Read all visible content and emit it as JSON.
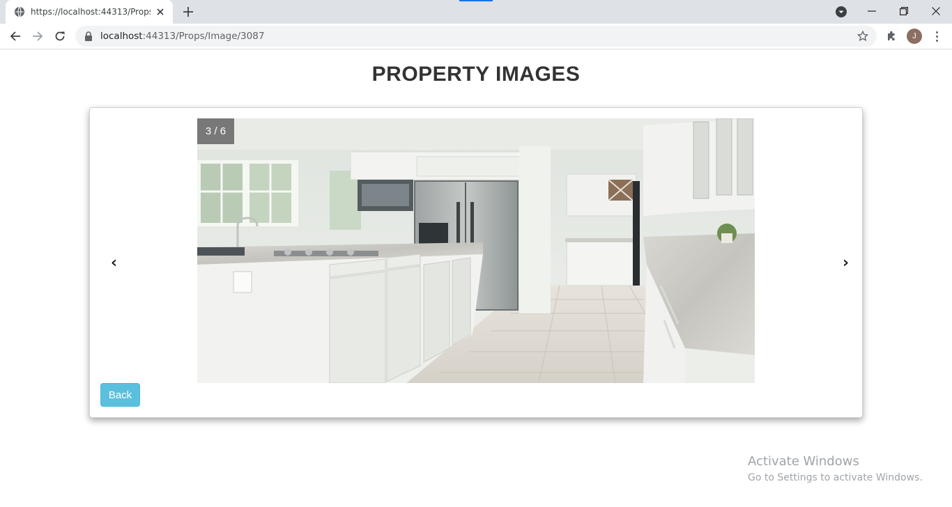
{
  "browser": {
    "tab_title": "https://localhost:44313/Props/Im",
    "url_host": "localhost",
    "url_rest": ":44313/Props/Image/3087",
    "profile_initial": "J"
  },
  "page": {
    "title": "PROPERTY IMAGES"
  },
  "carousel": {
    "counter": "3 / 6",
    "prev_label": "‹",
    "next_label": "›",
    "image_alt_icon": "kitchen-photo"
  },
  "actions": {
    "back_label": "Back"
  },
  "watermark": {
    "title": "Activate Windows",
    "subtitle": "Go to Settings to activate Windows."
  },
  "colors": {
    "accent_button": "#5bc0de",
    "tabstrip": "#dee1e6"
  }
}
